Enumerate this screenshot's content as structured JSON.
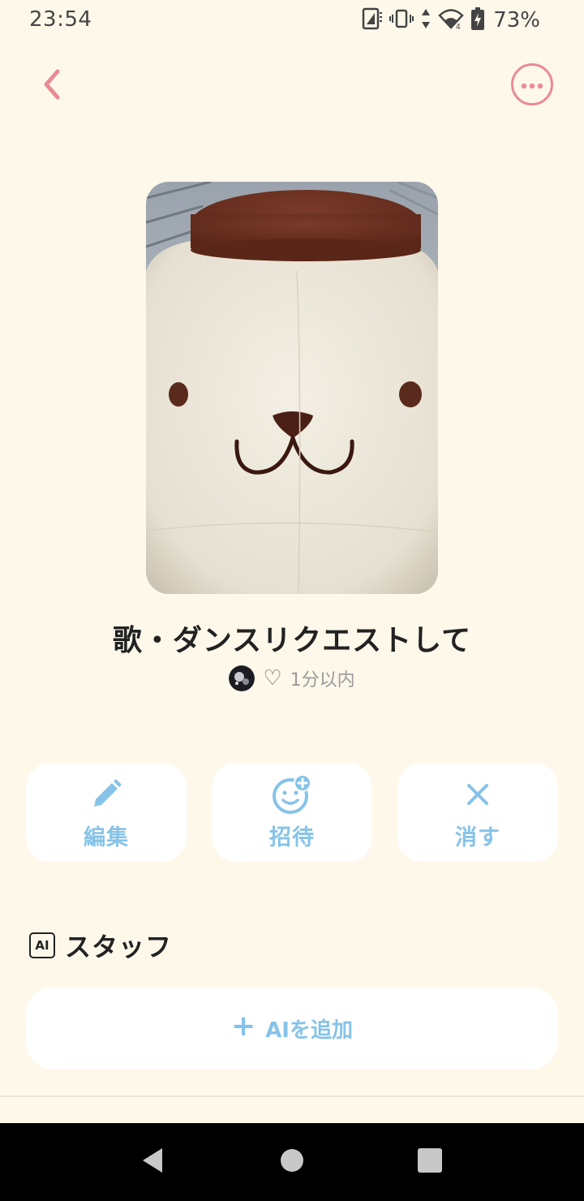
{
  "status_bar": {
    "time": "23:54",
    "battery": "73%",
    "icons": [
      "nfc-icon",
      "vibrate-icon",
      "data-arrows-icon",
      "wifi-icon",
      "battery-charging-icon"
    ]
  },
  "header": {
    "back_icon": "chevron-left-icon",
    "more_icon": "more-horizontal-icon",
    "accent_color": "#e98a94"
  },
  "room": {
    "title": "歌・ダンスリクエストして",
    "time_ago": "1分以内",
    "heart_icon": "♡"
  },
  "actions": [
    {
      "label": "編集",
      "icon": "pencil-icon"
    },
    {
      "label": "招待",
      "icon": "add-friend-icon"
    },
    {
      "label": "消す",
      "icon": "close-icon"
    }
  ],
  "staff": {
    "badge": "AI",
    "title": "スタッフ",
    "add_button_label": "AIを追加",
    "add_icon": "plus-icon"
  },
  "colors": {
    "background": "#fdf8ea",
    "action_blue": "#86c3e8",
    "card": "#ffffff"
  },
  "nav": {
    "back": "nav-back-icon",
    "home": "nav-home-icon",
    "recents": "nav-recents-icon"
  }
}
